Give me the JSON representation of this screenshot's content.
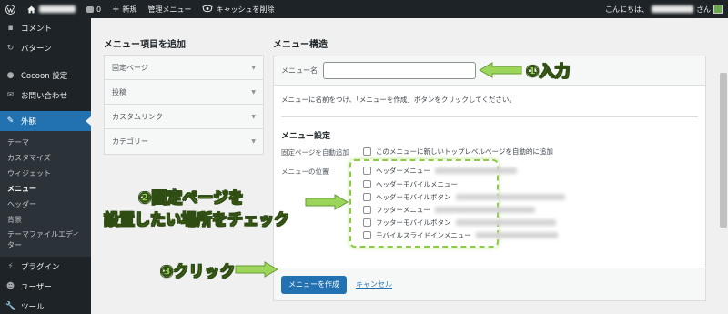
{
  "adminbar": {
    "comments_count": "0",
    "new_label": "新規",
    "manage_menu_label": "管理メニュー",
    "cache_label": "キャッシュを削除",
    "greeting": "こんにちは、",
    "honorific": "さん"
  },
  "sidebar": {
    "top_items": [
      {
        "label": "コメント",
        "icon": "comment-icon"
      },
      {
        "label": "パターン",
        "icon": "pattern-icon"
      },
      {
        "label": "Cocoon 設定",
        "icon": "cocoon-icon"
      },
      {
        "label": "お問い合わせ",
        "icon": "mail-icon"
      }
    ],
    "active": {
      "label": "外観",
      "icon": "brush-icon"
    },
    "sub_items": [
      "テーマ",
      "カスタマイズ",
      "ウィジェット",
      "メニュー",
      "ヘッダー",
      "背景",
      "テーマファイルエディター"
    ],
    "bottom_items": [
      {
        "label": "プラグイン",
        "icon": "plugin-icon"
      },
      {
        "label": "ユーザー",
        "icon": "user-icon"
      },
      {
        "label": "ツール",
        "icon": "tool-icon"
      }
    ]
  },
  "add_items": {
    "title": "メニュー項目を追加",
    "sections": [
      "固定ページ",
      "投稿",
      "カスタムリンク",
      "カテゴリー"
    ]
  },
  "structure": {
    "title": "メニュー構造",
    "name_label": "メニュー名",
    "name_value": "",
    "help_text": "メニューに名前をつけ、「メニューを作成」ボタンをクリックしてください。",
    "settings_title": "メニュー設定",
    "auto_add_label": "固定ページを自動追加",
    "auto_add_option": "このメニューに新しいトップレベルページを自動的に追加",
    "locations_label": "メニューの位置",
    "locations": [
      "ヘッダーメニュー",
      "ヘッダーモバイルメニュー",
      "ヘッダーモバイルボタン",
      "フッターメニュー",
      "フッターモバイルボタン",
      "モバイルスライドインメニュー"
    ],
    "create_button": "メニューを作成",
    "cancel_link": "キャンセル"
  },
  "annotations": {
    "step1": "①入力",
    "step2_line1": "②固定ページを",
    "step2_line2": "設置したい場所をチェック",
    "step3": "③クリック",
    "color": "#9bd55a"
  }
}
